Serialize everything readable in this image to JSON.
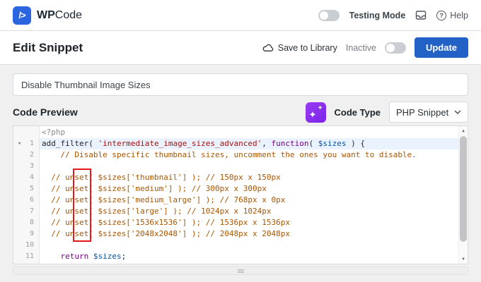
{
  "topbar": {
    "logo_glyph": "/>",
    "brand_bold": "WP",
    "brand_light": "Code",
    "testing_mode_label": "Testing Mode",
    "help_label": "Help"
  },
  "header": {
    "title": "Edit Snippet",
    "save_to_library_label": "Save to Library",
    "inactive_label": "Inactive",
    "update_label": "Update"
  },
  "snippet": {
    "title_value": "Disable Thumbnail Image Sizes"
  },
  "code_preview": {
    "heading": "Code Preview",
    "code_type_label": "Code Type",
    "code_type_value": "PHP Snippet"
  },
  "editor": {
    "lines": [
      {
        "num": "",
        "fold": false,
        "active": false,
        "segments": [
          {
            "t": "meta",
            "s": "<?php"
          }
        ]
      },
      {
        "num": "1",
        "fold": true,
        "active": true,
        "segments": [
          {
            "t": "plain",
            "s": "add_filter( "
          },
          {
            "t": "string",
            "s": "'intermediate_image_sizes_advanced'"
          },
          {
            "t": "plain",
            "s": ", "
          },
          {
            "t": "keyword",
            "s": "function"
          },
          {
            "t": "plain",
            "s": "( "
          },
          {
            "t": "variable",
            "s": "$sizes"
          },
          {
            "t": "plain",
            "s": " ) {"
          }
        ]
      },
      {
        "num": "2",
        "fold": false,
        "active": false,
        "segments": [
          {
            "t": "comment",
            "s": "    // Disable specific thumbnail sizes, uncomment the ones you want to disable."
          }
        ]
      },
      {
        "num": "3",
        "fold": false,
        "active": false,
        "segments": []
      },
      {
        "num": "4",
        "fold": false,
        "active": false,
        "segments": [
          {
            "t": "comment",
            "s": "  // unset( $sizes['thumbnail'] ); // 150px x 150px"
          }
        ]
      },
      {
        "num": "5",
        "fold": false,
        "active": false,
        "segments": [
          {
            "t": "comment",
            "s": "  // unset( $sizes['medium'] ); // 300px x 300px"
          }
        ]
      },
      {
        "num": "6",
        "fold": false,
        "active": false,
        "segments": [
          {
            "t": "comment",
            "s": "  // unset( $sizes['medium_large'] ); // 768px x 0px"
          }
        ]
      },
      {
        "num": "7",
        "fold": false,
        "active": false,
        "segments": [
          {
            "t": "comment",
            "s": "  // unset( $sizes['large'] ); // 1024px x 1024px"
          }
        ]
      },
      {
        "num": "8",
        "fold": false,
        "active": false,
        "segments": [
          {
            "t": "comment",
            "s": "  // unset( $sizes['1536x1536'] ); // 1536px x 1536px"
          }
        ]
      },
      {
        "num": "9",
        "fold": false,
        "active": false,
        "segments": [
          {
            "t": "comment",
            "s": "  // unset( $sizes['2048x2048'] ); // 2048px x 2048px"
          }
        ]
      },
      {
        "num": "10",
        "fold": false,
        "active": false,
        "segments": []
      },
      {
        "num": "11",
        "fold": false,
        "active": false,
        "segments": [
          {
            "t": "plain",
            "s": "    "
          },
          {
            "t": "keyword",
            "s": "return"
          },
          {
            "t": "plain",
            "s": " "
          },
          {
            "t": "variable",
            "s": "$sizes"
          },
          {
            "t": "plain",
            "s": ";"
          }
        ]
      }
    ],
    "annotation": {
      "shape": "rectangle",
      "color": "#e51a1a",
      "highlights": "comment markers // on lines 4-9"
    }
  },
  "colors": {
    "brand_blue": "#2b66e0",
    "update_button_blue": "#2262c6",
    "ai_button_purple": "#8a2ef0",
    "active_line_blue": "#e9f2fd",
    "annotation_red": "#e51a1a",
    "syntax_string": "#a11",
    "syntax_keyword": "#708",
    "syntax_variable": "#05a",
    "syntax_comment": "#a50"
  }
}
